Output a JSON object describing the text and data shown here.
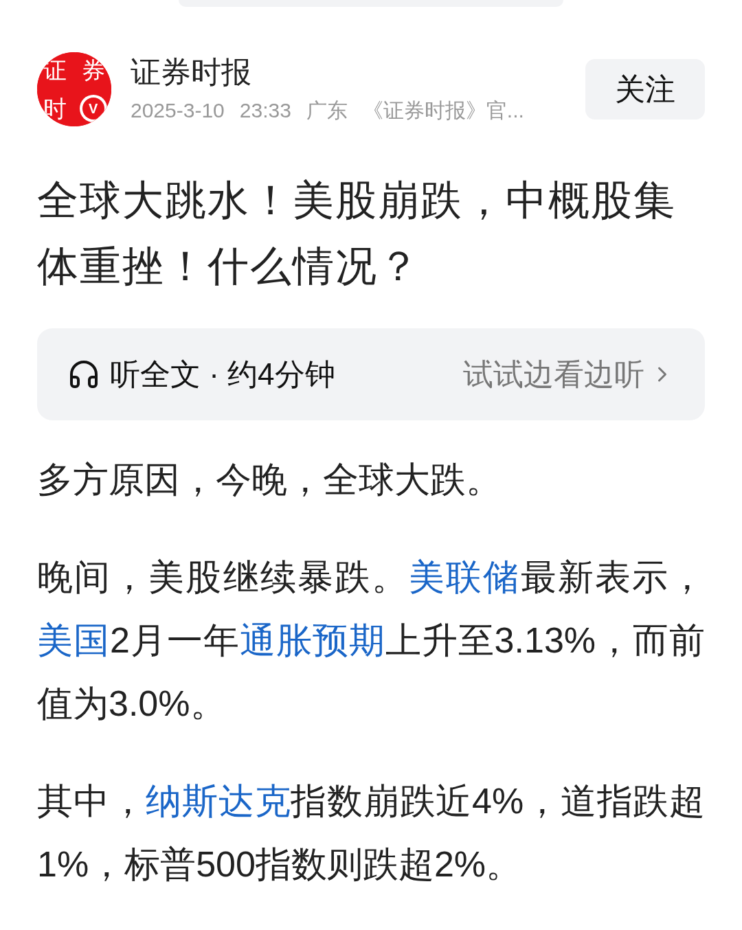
{
  "author": {
    "logo_chars": [
      "证",
      "券",
      "时"
    ],
    "verified_badge": "V",
    "name": "证券时报",
    "date": "2025-3-10",
    "time": "23:33",
    "region": "广东",
    "description": "《证券时报》官...",
    "follow_button": "关注"
  },
  "title": "全球大跳水！美股崩跌，中概股集体重挫！什么情况？",
  "listen_bar": {
    "label": "听全文 · 约4分钟",
    "action": "试试边看边听"
  },
  "paragraphs": [
    [
      {
        "text": "多方原因，今晚，全球大跌。",
        "link": false
      }
    ],
    [
      {
        "text": "晚间，美股继续暴跌。",
        "link": false
      },
      {
        "text": "美联储",
        "link": true
      },
      {
        "text": "最新表示，",
        "link": false
      },
      {
        "text": "美国",
        "link": true
      },
      {
        "text": "2月一年",
        "link": false
      },
      {
        "text": "通胀预期",
        "link": true
      },
      {
        "text": "上升至3.13%，而前值为3.0%。",
        "link": false
      }
    ],
    [
      {
        "text": "其中，",
        "link": false
      },
      {
        "text": "纳斯达克",
        "link": true
      },
      {
        "text": "指数崩跌近4%，道指跌超1%，标普500指数则跌超2%。",
        "link": false
      }
    ]
  ]
}
